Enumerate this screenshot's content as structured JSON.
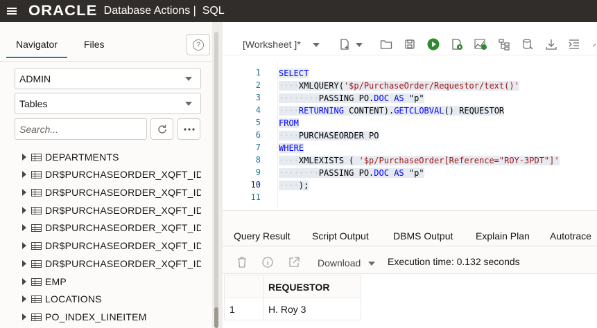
{
  "topbar": {
    "logo_text": "ORACLE",
    "app_title": "Database Actions |  SQL"
  },
  "navigator": {
    "tabs": [
      {
        "label": "Navigator",
        "active": true
      },
      {
        "label": "Files",
        "active": false
      }
    ],
    "schema_select": "ADMIN",
    "object_type_select": "Tables",
    "search_placeholder": "Search...",
    "tree_items": [
      {
        "label": "DEPARTMENTS"
      },
      {
        "label": "DR$PURCHASEORDER_XQFT_IDX$"
      },
      {
        "label": "DR$PURCHASEORDER_XQFT_IDX$"
      },
      {
        "label": "DR$PURCHASEORDER_XQFT_IDX$"
      },
      {
        "label": "DR$PURCHASEORDER_XQFT_IDX$"
      },
      {
        "label": "DR$PURCHASEORDER_XQFT_IDX$"
      },
      {
        "label": "DR$PURCHASEORDER_XQFT_IDX$"
      },
      {
        "label": "EMP"
      },
      {
        "label": "LOCATIONS"
      },
      {
        "label": "PO_INDEX_LINEITEM"
      }
    ]
  },
  "worksheet": {
    "title": "[Worksheet ]*",
    "line_numbers": [
      "1",
      "2",
      "3",
      "4",
      "5",
      "6",
      "7",
      "8",
      "9",
      "10",
      "11"
    ],
    "active_line": "10",
    "code": {
      "l1": "SELECT",
      "l2_a": "XMLQUERY(",
      "l2_b": "'$p/PurchaseOrder/Requestor/text()'",
      "l3_a": "PASSING PO.",
      "l3_b": "DOC",
      "l3_c": "AS",
      "l3_d": "\"p\"",
      "l4_a": "RETURNING",
      "l4_b": "CONTENT).",
      "l4_c": "GETCLOBVAL",
      "l4_d": "() REQUESTOR",
      "l5": "FROM",
      "l6": "PURCHASEORDER PO",
      "l7": "WHERE",
      "l8_a": "XMLEXISTS ( ",
      "l8_b": "'$p/PurchaseOrder[Reference=\"ROY-3PDT\"]'",
      "l9_a": "PASSING PO.",
      "l9_b": "DOC",
      "l9_c": "AS",
      "l9_d": "\"p\"",
      "l10": ");"
    }
  },
  "results": {
    "tabs": [
      "Query Result",
      "Script Output",
      "DBMS Output",
      "Explain Plan",
      "Autotrace"
    ],
    "active_tab": "Query Result",
    "download_label": "Download",
    "execution_time": "Execution time: 0.132 seconds",
    "columns": [
      "REQUESTOR"
    ],
    "rows": [
      {
        "num": "1",
        "REQUESTOR": "H. Roy 3"
      }
    ]
  },
  "colors": {
    "topbar_bg": "#312d2a",
    "accent": "#227e9e",
    "keyword": "#0000ff",
    "string": "#a31515",
    "run_green": "#2e8b2e"
  }
}
